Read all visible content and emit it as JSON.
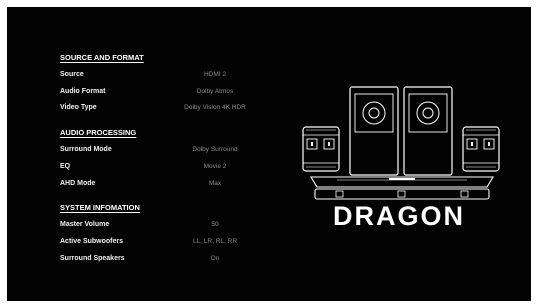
{
  "source_and_format": {
    "header": "SOURCE AND FORMAT",
    "rows": [
      {
        "label": "Source",
        "value": "HDMI 2"
      },
      {
        "label": "Audio Format",
        "value": "Dolby Atmos"
      },
      {
        "label": "Video Type",
        "value": "Dolby Vision 4K HDR"
      }
    ]
  },
  "audio_processing": {
    "header": "AUDIO PROCESSING",
    "rows": [
      {
        "label": "Surround Mode",
        "value": "Dolby Surround"
      },
      {
        "label": "EQ",
        "value": "Movie 2"
      },
      {
        "label": "AHD Mode",
        "value": "Max"
      }
    ]
  },
  "system_information": {
    "header": "SYSTEM INFOMATION",
    "rows": [
      {
        "label": "Master Volume",
        "value": "50"
      },
      {
        "label": "Active Subwoofers",
        "value": "LL, LR, RL, RR"
      },
      {
        "label": "Surround Speakers",
        "value": "On"
      }
    ]
  },
  "brand": {
    "name": "DRAGON"
  },
  "colors": {
    "background": "#030303",
    "label": "#f2f2f2",
    "value": "#8c8c8c"
  }
}
